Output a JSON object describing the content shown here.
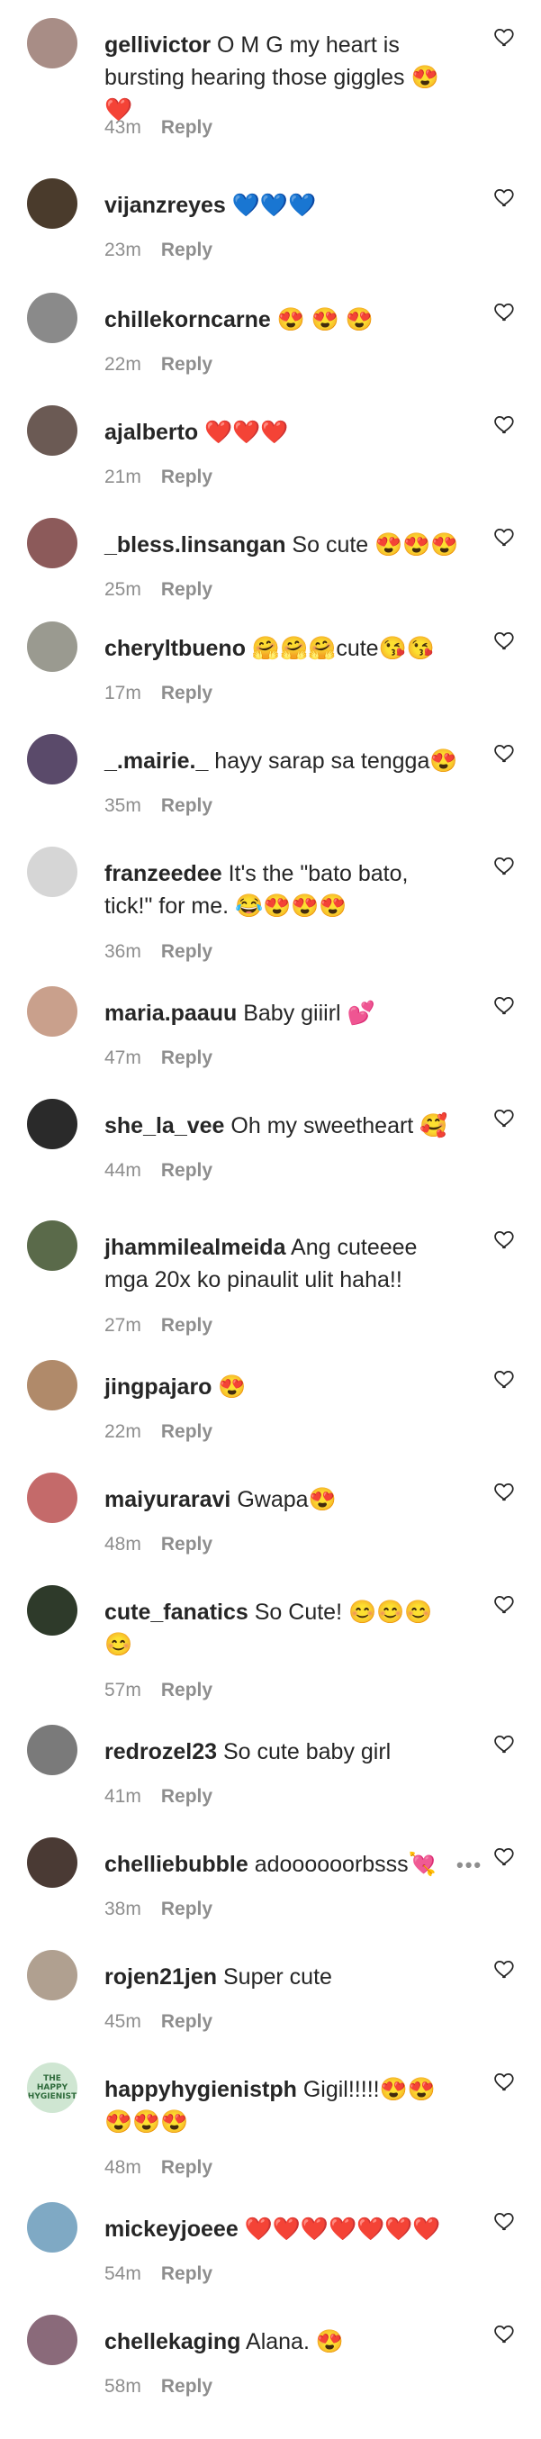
{
  "reply_label": "Reply",
  "like_icon": "heart-outline-icon",
  "colors": {
    "text": "#262626",
    "muted": "#8e8e8e"
  },
  "comments": [
    {
      "user": "gellivictor",
      "text": "O M G my heart is bursting hearing those giggles 😍 ❤️",
      "time": "43m",
      "avatar_color": "#a88d86"
    },
    {
      "user": "vijanzreyes",
      "text": "💙💙💙",
      "time": "23m",
      "avatar_color": "#4a3b2c"
    },
    {
      "user": "chillekorncarne",
      "text": "😍 😍 😍",
      "time": "22m",
      "avatar_color": "#8a8a8a"
    },
    {
      "user": "ajalberto",
      "text": "❤️❤️❤️",
      "time": "21m",
      "avatar_color": "#6b5a54"
    },
    {
      "user": "_bless.linsangan",
      "text": "So cute 😍😍😍",
      "time": "25m",
      "avatar_color": "#8c5a5a"
    },
    {
      "user": "cheryltbueno",
      "text": "🤗🤗🤗cute😘😘",
      "time": "17m",
      "avatar_color": "#9a9a90"
    },
    {
      "user": "_.mairie._",
      "text": "hayy sarap sa tengga😍",
      "time": "35m",
      "avatar_color": "#5a4a6a"
    },
    {
      "user": "franzeedee",
      "text": "It's the \"bato bato, tick!\" for me. 😂😍😍😍",
      "time": "36m",
      "avatar_color": "#d6d6d6"
    },
    {
      "user": "maria.paauu",
      "text": "Baby giiirl 💕",
      "time": "47m",
      "avatar_color": "#c9a08c"
    },
    {
      "user": "she_la_vee",
      "text": "Oh my sweetheart 🥰",
      "time": "44m",
      "avatar_color": "#2a2a2a"
    },
    {
      "user": "jhammilealmeida",
      "text": "Ang cuteeee mga 20x ko pinaulit ulit haha!!",
      "time": "27m",
      "avatar_color": "#5a6a4a"
    },
    {
      "user": "jingpajaro",
      "text": "😍",
      "time": "22m",
      "avatar_color": "#b08a6a"
    },
    {
      "user": "maiyuraravi",
      "text": "Gwapa😍",
      "time": "48m",
      "avatar_color": "#c46a6a"
    },
    {
      "user": "cute_fanatics",
      "text": "So Cute! 😊😊😊😊",
      "time": "57m",
      "avatar_color": "#2e3a2a"
    },
    {
      "user": "redrozel23",
      "text": "So cute baby girl",
      "time": "41m",
      "avatar_color": "#7a7a7a"
    },
    {
      "user": "chelliebubble",
      "text": "adoooooorbsss💘",
      "time": "38m",
      "avatar_color": "#4a3a34"
    },
    {
      "user": "rojen21jen",
      "text": "Super cute",
      "time": "45m",
      "avatar_color": "#b0a090"
    },
    {
      "user": "happyhygienistph",
      "text": "Gigil!!!!!😍😍😍😍😍",
      "time": "48m",
      "avatar_color": "#cfe6d2",
      "avatar_text": "THE HAPPY HYGIENIST"
    },
    {
      "user": "mickeyjoeee",
      "text": "❤️❤️❤️❤️❤️❤️❤️",
      "time": "54m",
      "avatar_color": "#7fa9c4"
    },
    {
      "user": "chellekaging",
      "text": "Alana. 😍",
      "time": "58m",
      "avatar_color": "#8a6a7a"
    }
  ]
}
